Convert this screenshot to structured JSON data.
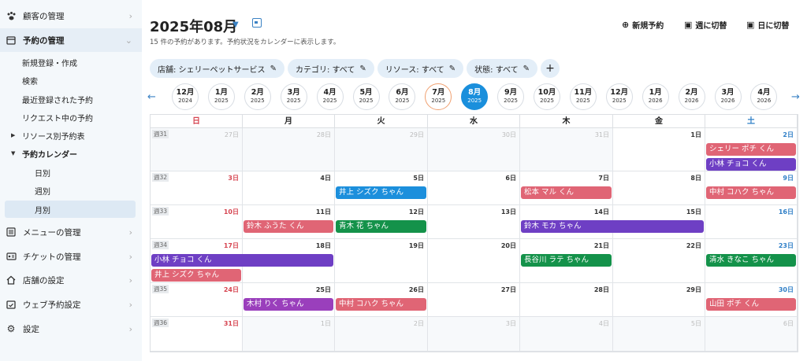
{
  "sidebar": {
    "customer": "顧客の管理",
    "reservation": "予約の管理",
    "sub": {
      "new": "新規登録・作成",
      "search": "検索",
      "recent": "最近登録された予約",
      "requesting": "リクエスト中の予約",
      "by_resource": "リソース別予約表",
      "calendar": "予約カレンダー",
      "daily": "日別",
      "weekly": "週別",
      "monthly": "月別"
    },
    "menu": "メニューの管理",
    "ticket": "チケットの管理",
    "store": "店舗の設定",
    "web": "ウェブ予約設定",
    "settings": "設定"
  },
  "header": {
    "title": "2025年08月",
    "subtitle": "15 件の予約があります。予約状況をカレンダーに表示します。",
    "new_reservation": "新規予約",
    "switch_week": "週に切替",
    "switch_day": "日に切替"
  },
  "filters": [
    "店舗: シェリーペットサービス",
    "カテゴリ: すべて",
    "リソース: すべて",
    "状態: すべて"
  ],
  "months": [
    {
      "m": "12",
      "y": "2024"
    },
    {
      "m": "1",
      "y": "2025"
    },
    {
      "m": "2",
      "y": "2025"
    },
    {
      "m": "3",
      "y": "2025"
    },
    {
      "m": "4",
      "y": "2025"
    },
    {
      "m": "5",
      "y": "2025"
    },
    {
      "m": "6",
      "y": "2025"
    },
    {
      "m": "7",
      "y": "2025"
    },
    {
      "m": "8",
      "y": "2025"
    },
    {
      "m": "9",
      "y": "2025"
    },
    {
      "m": "10",
      "y": "2025"
    },
    {
      "m": "11",
      "y": "2025"
    },
    {
      "m": "12",
      "y": "2025"
    },
    {
      "m": "1",
      "y": "2026"
    },
    {
      "m": "2",
      "y": "2026"
    },
    {
      "m": "3",
      "y": "2026"
    },
    {
      "m": "4",
      "y": "2026"
    }
  ],
  "month_suffix": "月",
  "weekdays": [
    "日",
    "月",
    "火",
    "水",
    "木",
    "金",
    "土"
  ],
  "weeks": [
    {
      "label": "週31",
      "days": [
        27,
        28,
        29,
        30,
        31,
        1,
        2
      ],
      "in": [
        false,
        false,
        false,
        false,
        false,
        true,
        true
      ]
    },
    {
      "label": "週32",
      "days": [
        3,
        4,
        5,
        6,
        7,
        8,
        9
      ],
      "in": [
        true,
        true,
        true,
        true,
        true,
        true,
        true
      ]
    },
    {
      "label": "週33",
      "days": [
        10,
        11,
        12,
        13,
        14,
        15,
        16
      ],
      "in": [
        true,
        true,
        true,
        true,
        true,
        true,
        true
      ]
    },
    {
      "label": "週34",
      "days": [
        17,
        18,
        19,
        20,
        21,
        22,
        23
      ],
      "in": [
        true,
        true,
        true,
        true,
        true,
        true,
        true
      ]
    },
    {
      "label": "週35",
      "days": [
        24,
        25,
        26,
        27,
        28,
        29,
        30
      ],
      "in": [
        true,
        true,
        true,
        true,
        true,
        true,
        true
      ]
    },
    {
      "label": "週36",
      "days": [
        31,
        1,
        2,
        3,
        4,
        5,
        6
      ],
      "in": [
        true,
        false,
        false,
        false,
        false,
        false,
        false
      ]
    }
  ],
  "day_suffix": "日",
  "events": [
    {
      "week": 0,
      "col": 6,
      "span": 1,
      "slot": 0,
      "name": "シェリー ポチ くん",
      "color": "pink"
    },
    {
      "week": 0,
      "col": 6,
      "span": 1,
      "slot": 1,
      "name": "小林 チョコ くん",
      "color": "purple"
    },
    {
      "week": 1,
      "col": 2,
      "span": 1,
      "slot": 0,
      "name": "井上 シズク ちゃん",
      "color": "blue"
    },
    {
      "week": 1,
      "col": 4,
      "span": 1,
      "slot": 0,
      "name": "松本 マル くん",
      "color": "pink"
    },
    {
      "week": 1,
      "col": 6,
      "span": 1,
      "slot": 0,
      "name": "中村 コハク ちゃん",
      "color": "pink"
    },
    {
      "week": 2,
      "col": 1,
      "span": 1,
      "slot": 0,
      "name": "鈴木 ふうた くん",
      "color": "pink"
    },
    {
      "week": 2,
      "col": 2,
      "span": 1,
      "slot": 0,
      "name": "青木 花 ちゃん",
      "color": "green"
    },
    {
      "week": 2,
      "col": 4,
      "span": 2,
      "slot": 0,
      "name": "鈴木 モカ ちゃん",
      "color": "purple"
    },
    {
      "week": 3,
      "col": 0,
      "span": 2,
      "slot": 0,
      "name": "小林 チョコ くん",
      "color": "purple"
    },
    {
      "week": 3,
      "col": 0,
      "span": 1,
      "slot": 1,
      "name": "井上 シズク ちゃん",
      "color": "pink"
    },
    {
      "week": 3,
      "col": 4,
      "span": 1,
      "slot": 0,
      "name": "長谷川 ラテ ちゃん",
      "color": "green"
    },
    {
      "week": 3,
      "col": 6,
      "span": 1,
      "slot": 0,
      "name": "清水 きなこ ちゃん",
      "color": "green"
    },
    {
      "week": 4,
      "col": 1,
      "span": 1,
      "slot": 0,
      "name": "木村 りく ちゃん",
      "color": "violet"
    },
    {
      "week": 4,
      "col": 2,
      "span": 1,
      "slot": 0,
      "name": "中村 コハク ちゃん",
      "color": "pink"
    },
    {
      "week": 4,
      "col": 6,
      "span": 1,
      "slot": 0,
      "name": "山田 ポチ くん",
      "color": "pink"
    }
  ],
  "colors": {
    "sunday": "#d64551",
    "saturday": "#2f7fc7",
    "today_ring": "#f0a070",
    "current": "#1a8fdc"
  }
}
